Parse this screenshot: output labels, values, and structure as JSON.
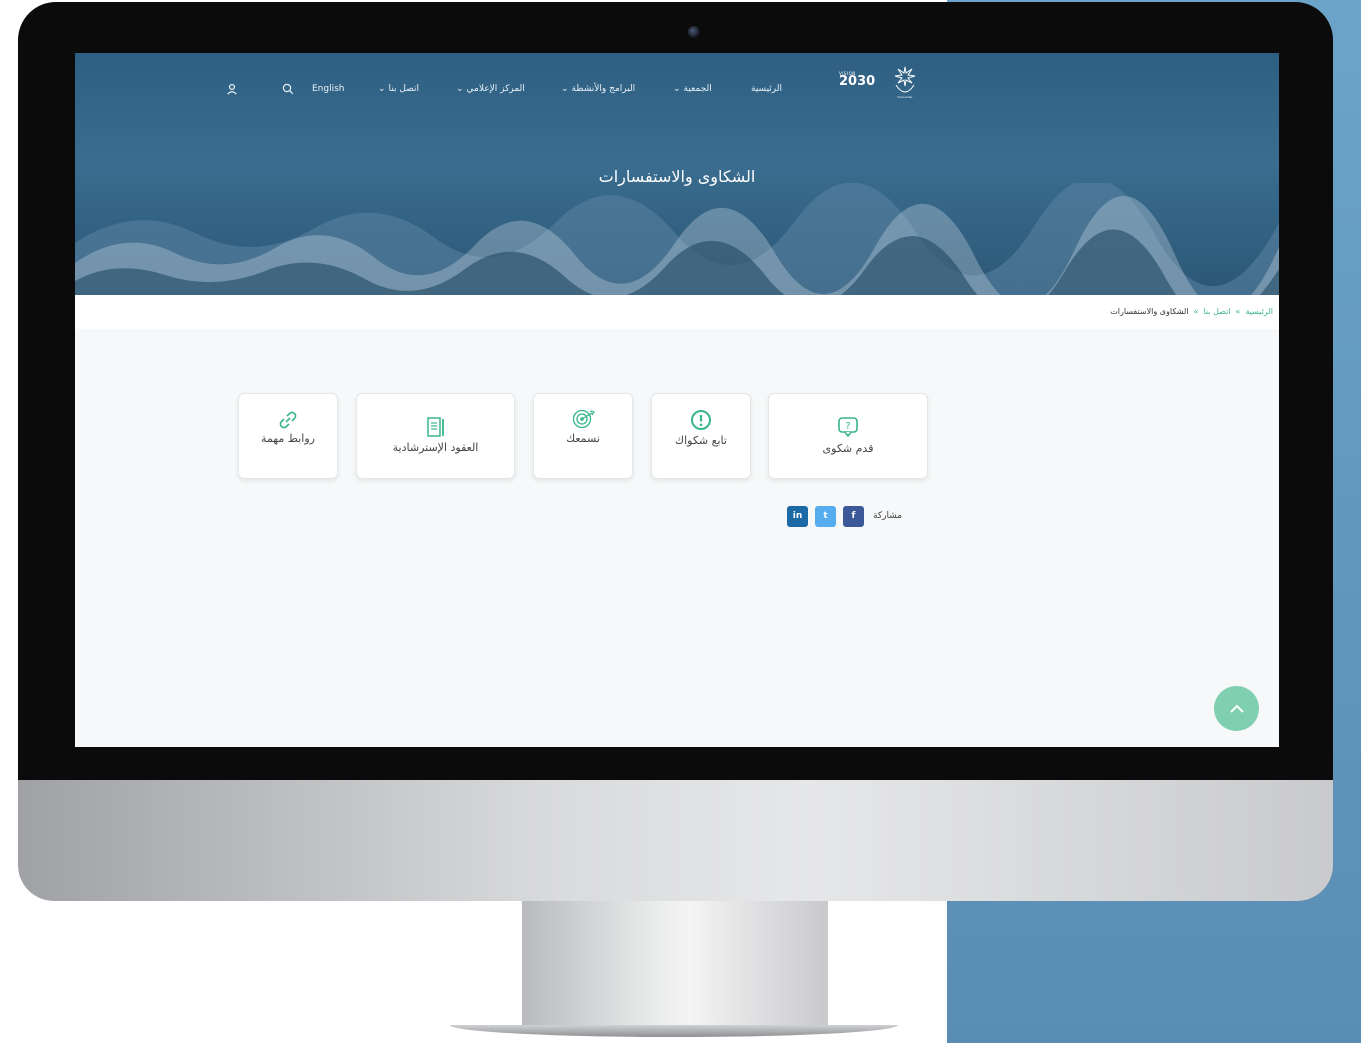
{
  "nav": {
    "home": "الرئيسية",
    "association": "الجمعية",
    "programs": "البرامج والأنشطة",
    "media": "المركز الإعلامي",
    "contact": "اتصل بنا",
    "language": "English",
    "search_icon": "search-icon",
    "user_icon": "user-icon"
  },
  "logo": {
    "vision_small": "VISION",
    "vision_number": "2030",
    "org_name": "Consumer"
  },
  "hero": {
    "title": "الشكاوى والاستفسارات"
  },
  "breadcrumb": {
    "home": "الرئيسية",
    "contact": "اتصل بنا",
    "current": "الشكاوى والاستفسارات",
    "separator": "»"
  },
  "cards": [
    {
      "label": "قدم شكوى",
      "icon": "question-bubble-icon"
    },
    {
      "label": "تابع شكواك",
      "icon": "alert-circle-icon"
    },
    {
      "label": "نسمعك",
      "icon": "target-icon"
    },
    {
      "label": "العقود الإسترشادية",
      "icon": "document-icon"
    },
    {
      "label": "روابط مهمة",
      "icon": "link-icon"
    }
  ],
  "share": {
    "label": "مشاركة",
    "facebook": "f",
    "twitter": "t",
    "linkedin": "in"
  },
  "colors": {
    "accent": "#38b58a",
    "hero": "#2e5f82",
    "facebook": "#3b5998",
    "twitter": "#55acee",
    "linkedin": "#1b6aa5",
    "to_top": "#7fcfb0"
  }
}
